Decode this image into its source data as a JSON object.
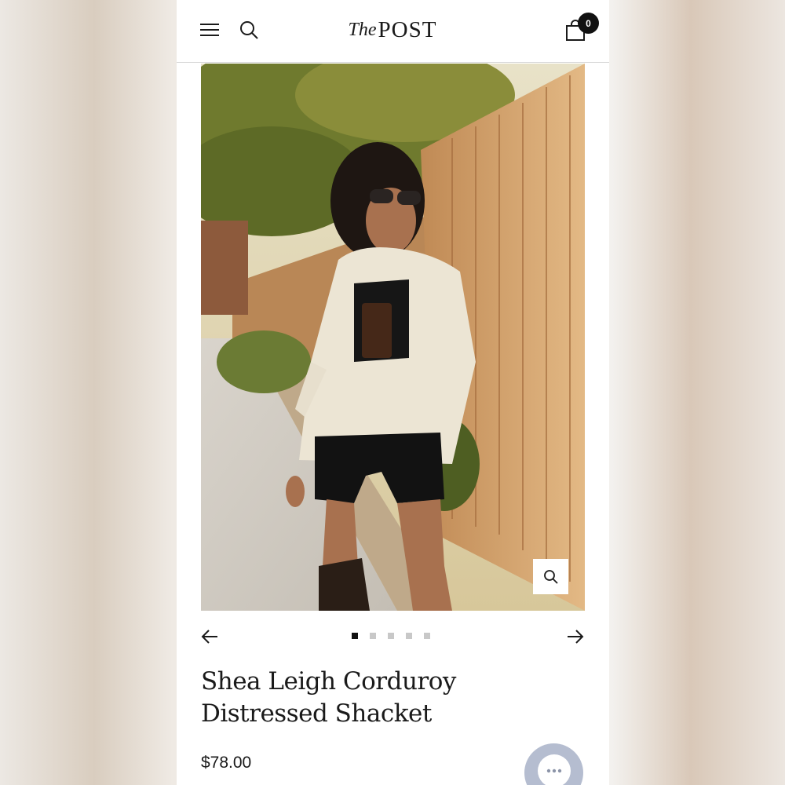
{
  "header": {
    "logo_the": "The",
    "logo_post": "POST",
    "cart_count": "0"
  },
  "product": {
    "title": "Shea Leigh Corduroy Distressed Shacket",
    "price": "$78.00",
    "image_alt": "Model wearing a cream corduroy shacket over a black crop top and bike shorts"
  },
  "gallery": {
    "slide_count": 5,
    "active_slide": 1
  },
  "icons": {
    "menu": "hamburger-menu-icon",
    "search": "search-icon",
    "cart": "shopping-bag-icon",
    "zoom": "zoom-icon",
    "prev": "arrow-left-icon",
    "next": "arrow-right-icon",
    "chat": "chat-icon"
  },
  "colors": {
    "accent": "#111111",
    "dot_inactive": "#c8c8c8",
    "chat_bubble": "#b5bdd0"
  }
}
